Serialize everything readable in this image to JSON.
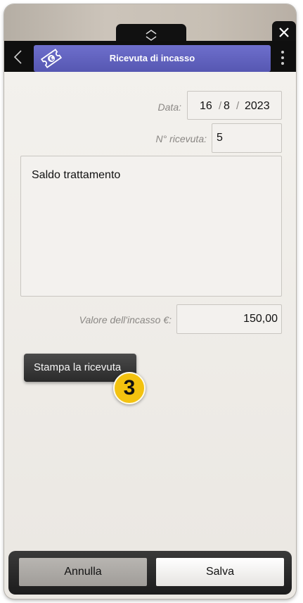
{
  "window": {
    "close_icon": "close-icon",
    "pull_tab_icon": "chevrons-icon"
  },
  "header": {
    "title": "Ricevuta di incasso",
    "icon": "ticket-euro-icon",
    "accent_color": "#5f60bf"
  },
  "form": {
    "date_label": "Data:",
    "date_day": "16",
    "date_sep": "/",
    "date_month": "8",
    "date_year": "2023",
    "receipt_number_label": "N° ricevuta:",
    "receipt_number": "5",
    "description": "Saldo trattamento",
    "amount_label": "Valore dell'incasso €:",
    "amount": "150,00"
  },
  "actions": {
    "print_label": "Stampa la ricevuta",
    "step_badge": "3",
    "cancel_label": "Annulla",
    "save_label": "Salva"
  }
}
